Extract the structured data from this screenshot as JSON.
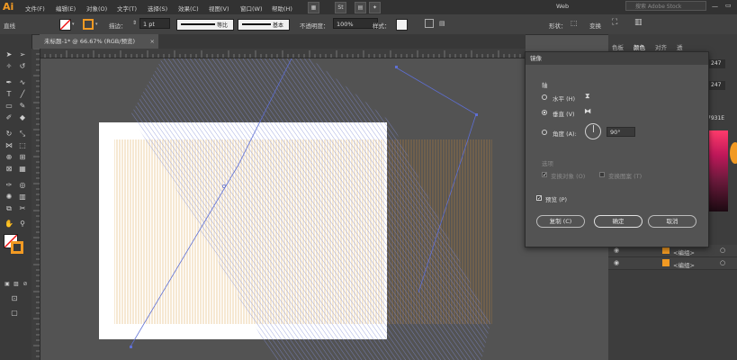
{
  "menubar": {
    "logo": "Ai",
    "menus": [
      "文件(F)",
      "编辑(E)",
      "对象(O)",
      "文字(T)",
      "选择(S)",
      "效果(C)",
      "视图(V)",
      "窗口(W)",
      "帮助(H)"
    ],
    "workspace": "Web",
    "search_placeholder": "搜索 Adobe Stock"
  },
  "control_bar": {
    "selection_label": "直线",
    "stroke_label": "描边：",
    "stroke_weight": "1 pt",
    "profile_label": "等比",
    "brush_label": "基本",
    "opacity_label": "不透明度：",
    "opacity_value": "100%",
    "style_label": "样式：",
    "shape_label": "形状：",
    "transform_label": "变换",
    "fill_color": "#ffffff",
    "stroke_color": "#f29a23"
  },
  "document_tab": {
    "title": "未标题-1* @ 66.67% (RGB/预览)"
  },
  "right_panel": {
    "tabs": [
      "色板",
      "颜色",
      "对齐",
      "透"
    ],
    "values": [
      "247",
      "247",
      "7931E"
    ],
    "layers": [
      {
        "name": "<编组>"
      },
      {
        "name": "<编组>"
      }
    ]
  },
  "dialog": {
    "title": "镜像",
    "axis_section": "轴",
    "horizontal_label": "水平 (H)",
    "vertical_label": "垂直 (V)",
    "angle_label": "角度 (A):",
    "angle_value": "90°",
    "options_section": "选项",
    "transform_objects_label": "变换对象 (O)",
    "transform_patterns_label": "变换图案 (T)",
    "preview_label": "预览 (P)",
    "copy_button": "复制 (C)",
    "ok_button": "确定",
    "cancel_button": "取消",
    "selected_axis": "vertical",
    "preview_checked": true
  }
}
